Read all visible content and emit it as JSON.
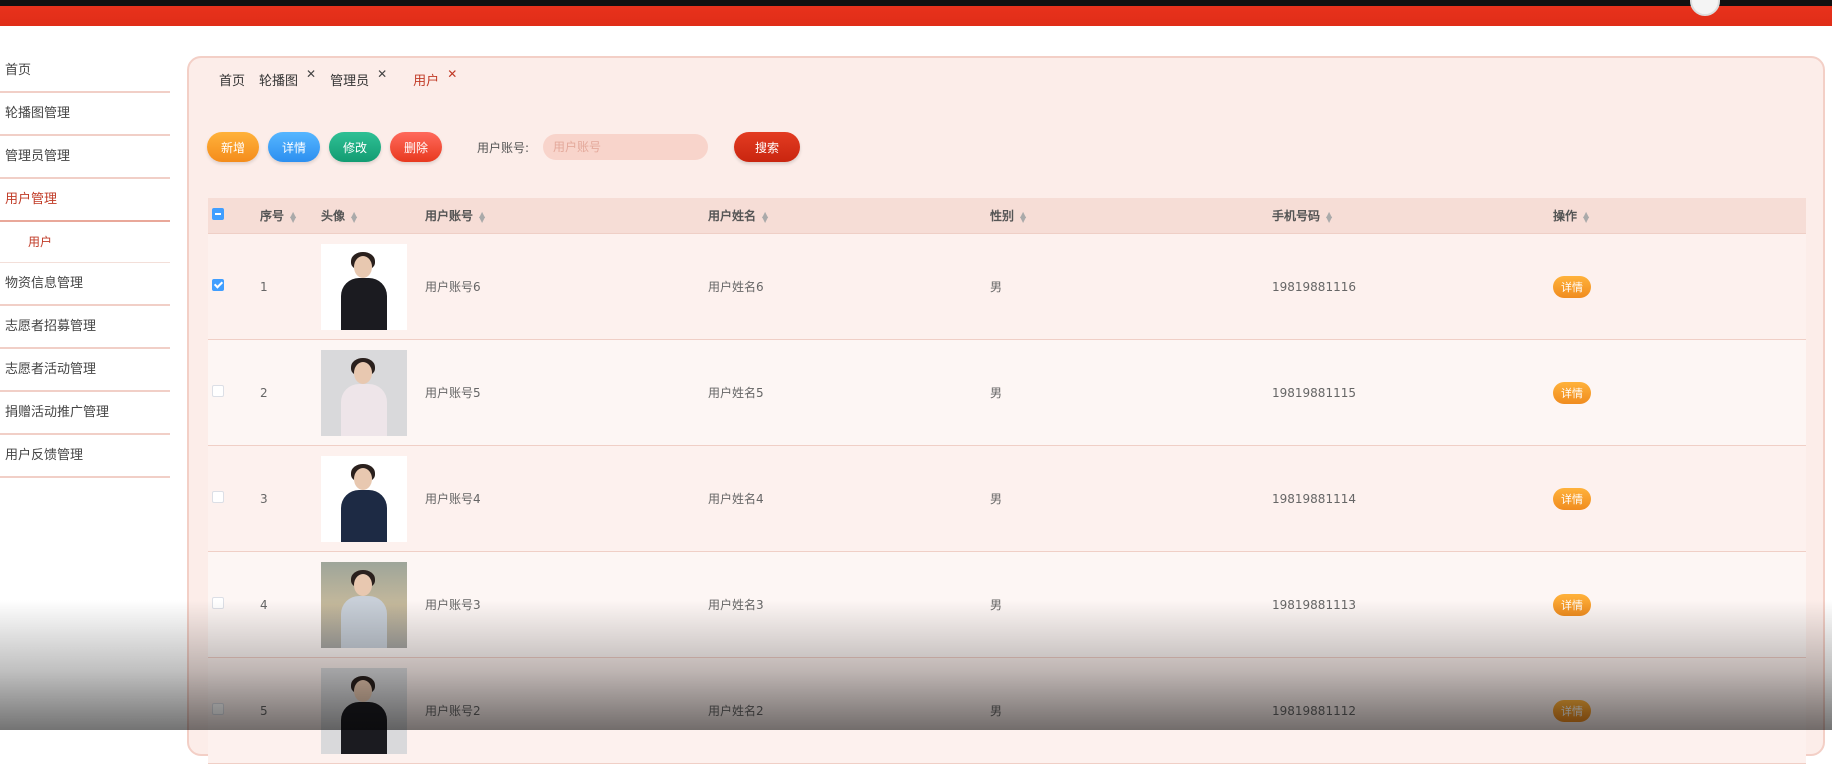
{
  "sidebar": {
    "items": [
      {
        "label": "首页"
      },
      {
        "label": "轮播图管理"
      },
      {
        "label": "管理员管理"
      },
      {
        "label": "用户管理"
      },
      {
        "label": "用户"
      },
      {
        "label": "物资信息管理"
      },
      {
        "label": "志愿者招募管理"
      },
      {
        "label": "志愿者活动管理"
      },
      {
        "label": "捐赠活动推广管理"
      },
      {
        "label": "用户反馈管理"
      }
    ]
  },
  "tabs": [
    {
      "label": "首页"
    },
    {
      "label": "轮播图"
    },
    {
      "label": "管理员"
    },
    {
      "label": "用户"
    }
  ],
  "toolbar": {
    "add_label": "新增",
    "detail_label": "详情",
    "edit_label": "修改",
    "delete_label": "删除",
    "search_label": "用户账号:",
    "search_placeholder": "用户账号",
    "search_button": "搜索"
  },
  "table": {
    "columns": [
      "序号",
      "头像",
      "用户账号",
      "用户姓名",
      "性别",
      "手机号码",
      "操作"
    ],
    "rows": [
      {
        "index": "1",
        "account": "用户账号6",
        "name": "用户姓名6",
        "gender": "男",
        "phone": "19819881116",
        "action": "详情",
        "checked": true
      },
      {
        "index": "2",
        "account": "用户账号5",
        "name": "用户姓名5",
        "gender": "男",
        "phone": "19819881115",
        "action": "详情",
        "checked": false
      },
      {
        "index": "3",
        "account": "用户账号4",
        "name": "用户姓名4",
        "gender": "男",
        "phone": "19819881114",
        "action": "详情",
        "checked": false
      },
      {
        "index": "4",
        "account": "用户账号3",
        "name": "用户姓名3",
        "gender": "男",
        "phone": "19819881113",
        "action": "详情",
        "checked": false
      },
      {
        "index": "5",
        "account": "用户账号2",
        "name": "用户姓名2",
        "gender": "男",
        "phone": "19819881112",
        "action": "详情",
        "checked": false
      }
    ]
  },
  "colors": {
    "topbar": "#e8321c",
    "accent": "#c03a26",
    "panel": "#fcede9"
  }
}
